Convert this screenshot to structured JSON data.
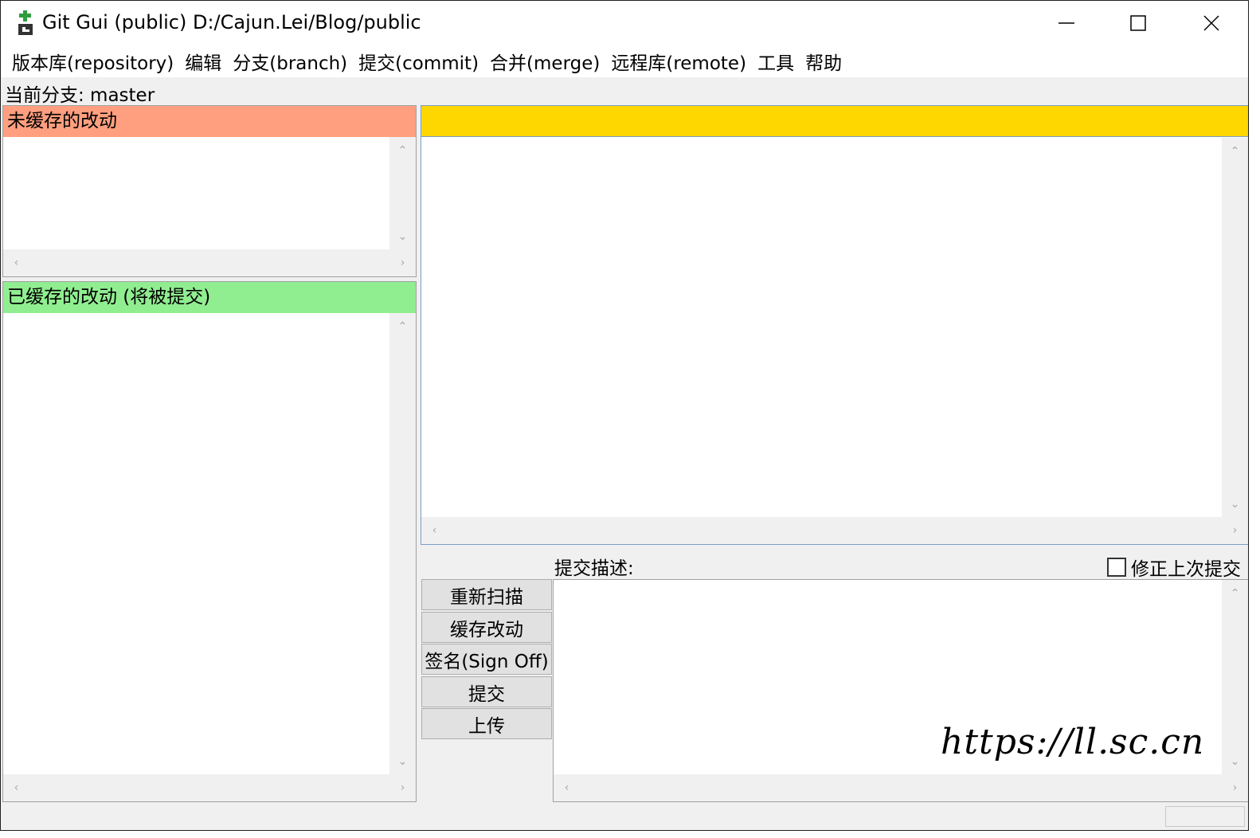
{
  "window": {
    "title": "Git Gui (public) D:/Cajun.Lei/Blog/public",
    "icon": "git-gui-icon"
  },
  "menu": [
    "版本库(repository)",
    "编辑",
    "分支(branch)",
    "提交(commit)",
    "合并(merge)",
    "远程库(remote)",
    "工具",
    "帮助"
  ],
  "branch": {
    "text": "当前分支: master"
  },
  "unstaged": {
    "title": "未缓存的改动",
    "color": "#ff9f7f"
  },
  "staged": {
    "title": "已缓存的改动 (将被提交)",
    "color": "#90ee90"
  },
  "diff": {
    "header_color": "#ffd700"
  },
  "buttons": {
    "rescan": "重新扫描",
    "stage": "缓存改动",
    "signoff": "签名(Sign Off)",
    "commit": "提交",
    "push": "上传"
  },
  "commit_message": {
    "label": "提交描述:",
    "amend_label": "修正上次提交",
    "amend_checked": false
  },
  "watermark": "https://ll.sc.cn"
}
